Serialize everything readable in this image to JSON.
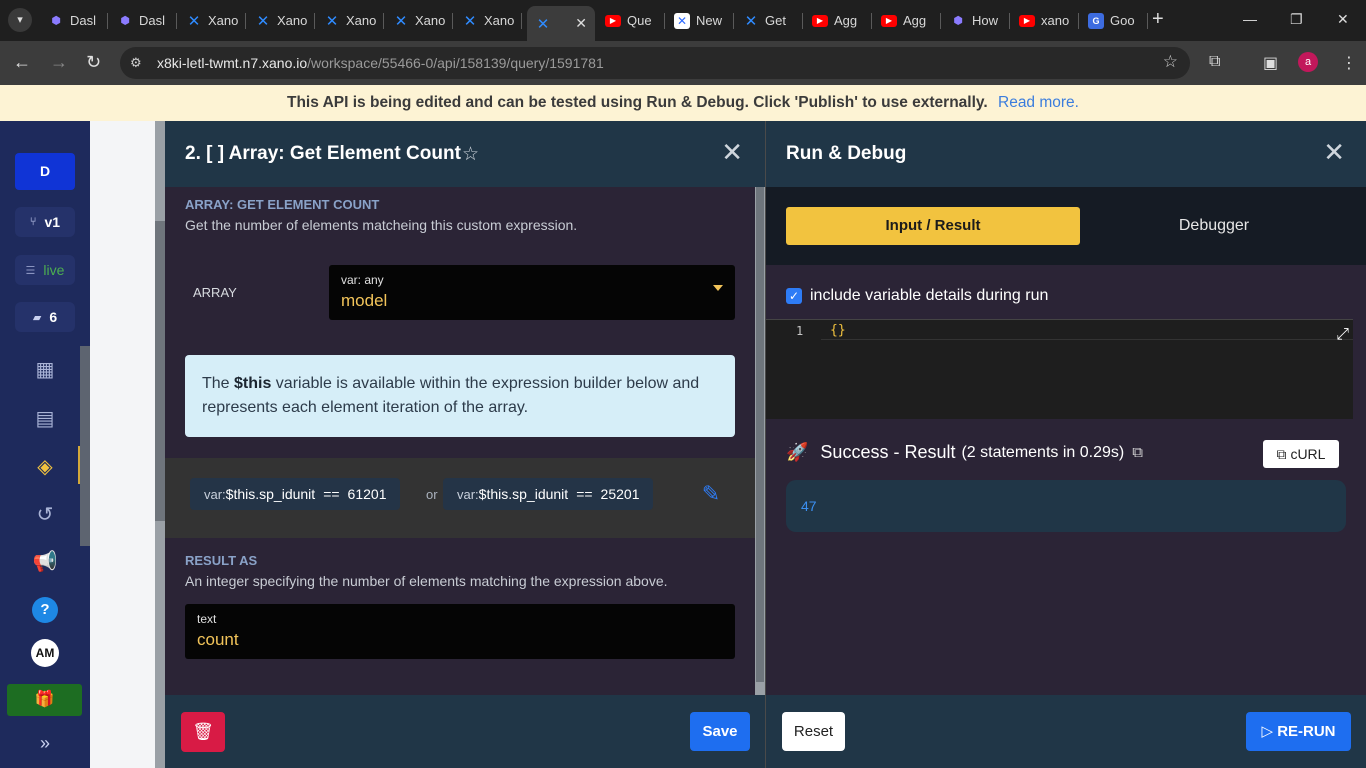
{
  "browser": {
    "tabs": [
      {
        "label": "Dasl",
        "icon": "dashboard-cube-icon"
      },
      {
        "label": "Dasl",
        "icon": "dashboard-cube-icon"
      },
      {
        "label": "Xano",
        "icon": "xano-icon"
      },
      {
        "label": "Xano",
        "icon": "xano-icon"
      },
      {
        "label": "Xano",
        "icon": "xano-icon"
      },
      {
        "label": "Xano",
        "icon": "xano-icon"
      },
      {
        "label": "Xano",
        "icon": "xano-icon"
      },
      {
        "label": "",
        "icon": "xano-icon"
      },
      {
        "label": "Que",
        "icon": "youtube-icon"
      },
      {
        "label": "New",
        "icon": "xano-icon"
      },
      {
        "label": "Get",
        "icon": "xano-icon"
      },
      {
        "label": "Agg",
        "icon": "youtube-icon"
      },
      {
        "label": "Agg",
        "icon": "youtube-icon"
      },
      {
        "label": "How",
        "icon": "cube-icon"
      },
      {
        "label": "xano",
        "icon": "youtube-icon"
      },
      {
        "label": "Goo",
        "icon": "google-translate-icon"
      }
    ],
    "url_host": "x8ki-letl-twmt.n7.xano.io",
    "url_path": "/workspace/55466-0/api/158139/query/1591781",
    "profile_initial": "a"
  },
  "banner": {
    "message": "This API is being edited and can be tested using Run & Debug. Click 'Publish' to use externally.",
    "link": "Read more."
  },
  "sidebar": {
    "workspace_initial": "D",
    "version": "v1",
    "status": "live",
    "comments_count": "6",
    "user_initials": "AM"
  },
  "function_panel": {
    "title": "2. [ ] Array: Get Element Count",
    "section_label": "ARRAY: GET ELEMENT COUNT",
    "section_desc": "Get the number of elements matcheing this custom expression.",
    "array_label": "ARRAY",
    "array_type": "var: any",
    "array_value": "model",
    "info_pre": "The ",
    "info_var": "$this",
    "info_post": " variable is available within the expression builder below and represents each element iteration of the array.",
    "expr1": {
      "prefix": "var:",
      "var": "$this.sp_idunit",
      "op": "==",
      "value": "61201"
    },
    "expr_or": "or",
    "expr2": {
      "prefix": "var:",
      "var": "$this.sp_idunit",
      "op": "==",
      "value": "25201"
    },
    "result_label": "RESULT AS",
    "result_desc": "An integer specifying the number of elements matching the expression above.",
    "result_type": "text",
    "result_value": "count",
    "save_label": "Save"
  },
  "run_debug": {
    "title": "Run & Debug",
    "tab_input": "Input / Result",
    "tab_debugger": "Debugger",
    "include_vars_label": "include variable details during run",
    "editor_line": "1",
    "editor_code": "{}",
    "result_title": "Success - Result",
    "result_meta": "(2 statements in 0.29s)",
    "curl_label": "cURL",
    "result_value": "47",
    "reset_label": "Reset",
    "rerun_label": "RE-RUN"
  }
}
